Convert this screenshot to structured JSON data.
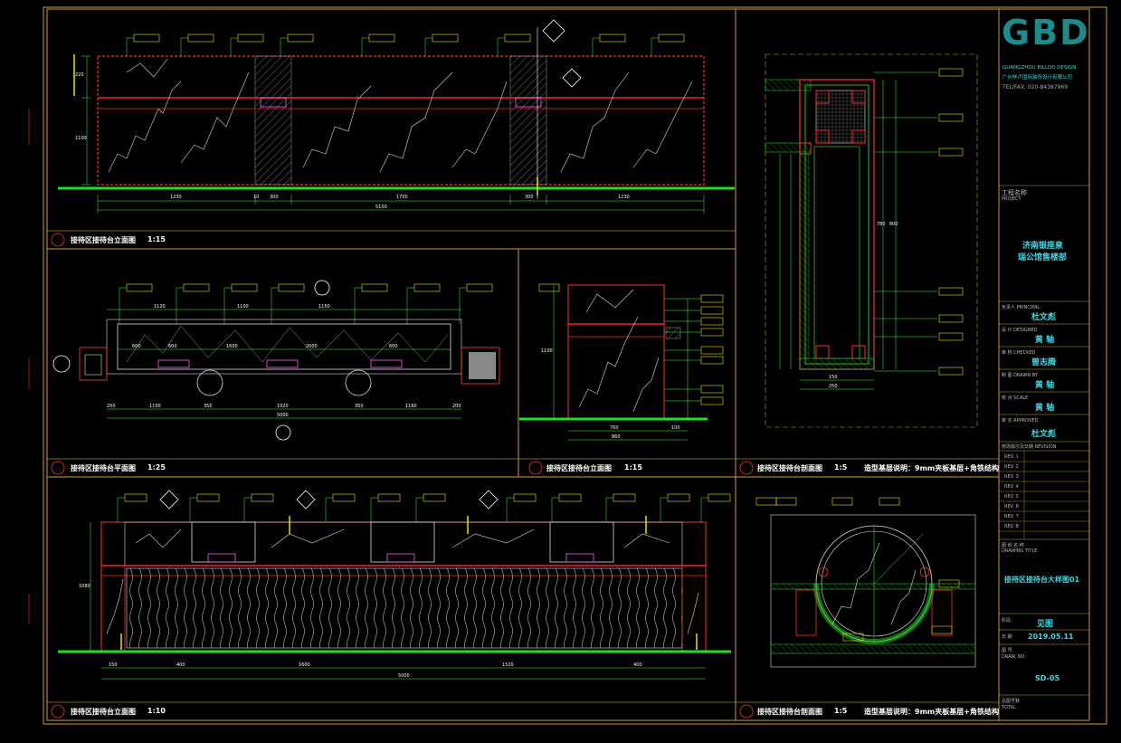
{
  "drawings": {
    "d1": {
      "title": "接待区接待台立面图",
      "scale": "1:15",
      "dims": [
        "1230",
        "10",
        "300",
        "1700",
        "300",
        "1230",
        "5100"
      ],
      "height_dims": [
        "220",
        "1100"
      ]
    },
    "d2": {
      "title": "接待区接待台平面图",
      "scale": "1:25",
      "dims_top": [
        "1120",
        "1100",
        "1150"
      ],
      "dims_bottom": [
        "200",
        "1100",
        "350",
        "1020",
        "350",
        "1160",
        "200"
      ],
      "total": "5000",
      "inner": [
        "600",
        "600",
        "1600",
        "2000",
        "600"
      ]
    },
    "d3": {
      "title": "接待区接待台立面图",
      "scale": "1:15",
      "dims": [
        "760",
        "100",
        "860"
      ],
      "height_dims": [
        "1100"
      ]
    },
    "d4": {
      "title": "接待区接待台剖面图",
      "scale": "1:5",
      "note": "造型基层说明：9mm夹板基层+角铁结构",
      "dims": [
        "150",
        "250"
      ],
      "height_dims": [
        "780",
        "800"
      ]
    },
    "d5": {
      "title": "接待区接待台立面图",
      "scale": "1:10",
      "dims": [
        "150",
        "400",
        "1600",
        "1520",
        "400"
      ],
      "total": "5000",
      "height_dims": [
        "1080"
      ]
    },
    "d6": {
      "title": "接待区接待台剖面图",
      "scale": "1:5",
      "note": "造型基层说明：9mm夹板基层+角铁结构"
    }
  },
  "title_block": {
    "logo": "GBD",
    "company_en": "GUANGZHOU BILLOO DESIGN",
    "company_cn": "广州毕卢国际装饰设计有限公司",
    "tel": "TEL/FAX: 020-84387969",
    "project_label": "工程名称",
    "project_label_en": "PROJECT",
    "project_name_1": "济南银座泉",
    "project_name_2": "瑞公馆售楼部",
    "principal_label": "负责人 PRINCIPAL",
    "principal": "杜文彪",
    "design_label": "设 计 DESIGNED",
    "design": "黄 轴",
    "check_label": "审 核 CHECKED",
    "check": "曾志腾",
    "drawn_label": "制 图 DRAWN BY",
    "drawn": "黄 轴",
    "scale_label": "校 对 SCALE",
    "scale": "黄 轴",
    "approved_label": "审 定 APPROVED",
    "approved": "杜文彪",
    "revisions_label": "修改版次及日期 REVISION",
    "revisions": [
      "REV. 1",
      "REV. 2",
      "REV. 3",
      "REV. 4",
      "REV. 5",
      "REV. 6",
      "REV. 7",
      "REV. 8"
    ],
    "drawing_title_label": "图 纸 名 称",
    "drawing_title_en": "DRAWING TITLE",
    "drawing_title": "接待区接待台大样图01",
    "stage_label": "阶段",
    "stage": "见图",
    "date_label": "日 期",
    "date": "2019.05.11",
    "number_label": "图 号.",
    "number_label_en": "DRAW. NO.",
    "number": "SD-05",
    "total_label": "总图号数",
    "total_label_en": "TOTAL"
  },
  "colors": {
    "frame": "#c8a030",
    "floor": "#20e020",
    "accent": "#ff2020",
    "marble": "#c8c8c8",
    "leader": "#40ff40",
    "cyan": "#3fd8e0"
  }
}
